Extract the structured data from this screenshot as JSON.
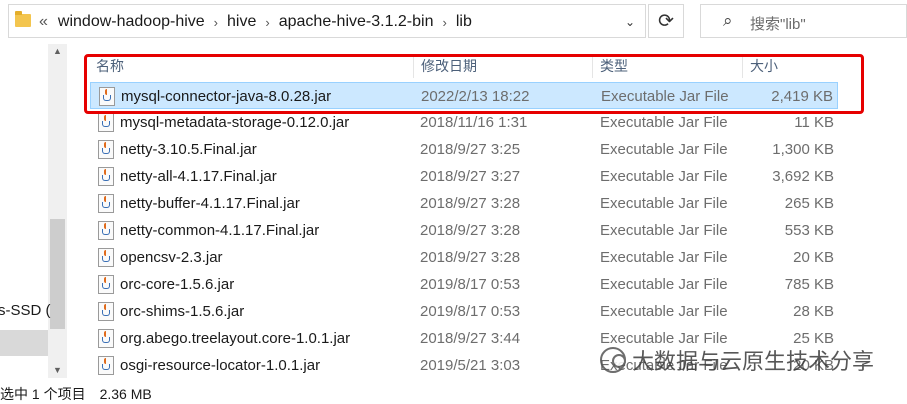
{
  "address_bar": {
    "overflow_glyph": "«",
    "crumbs": [
      "window-hadoop-hive",
      "hive",
      "apache-hive-3.1.2-bin",
      "lib"
    ],
    "separator": "›",
    "dropdown_glyph": "⌄"
  },
  "refresh_glyph": "⟳",
  "search": {
    "icon_glyph": "⌕",
    "placeholder": "搜索\"lib\""
  },
  "nav": {
    "drive_label": "s-SSD (",
    "scroll_up": "▲",
    "scroll_down": "▼"
  },
  "columns": {
    "name": "名称",
    "date": "修改日期",
    "type": "类型",
    "size": "大小"
  },
  "files": [
    {
      "name": "mysql-connector-java-8.0.28.jar",
      "date": "2022/2/13 18:22",
      "type": "Executable Jar File",
      "size": "2,419 KB",
      "selected": true
    },
    {
      "name": "mysql-metadata-storage-0.12.0.jar",
      "date": "2018/11/16 1:31",
      "type": "Executable Jar File",
      "size": "11 KB",
      "selected": false
    },
    {
      "name": "netty-3.10.5.Final.jar",
      "date": "2018/9/27 3:25",
      "type": "Executable Jar File",
      "size": "1,300 KB",
      "selected": false
    },
    {
      "name": "netty-all-4.1.17.Final.jar",
      "date": "2018/9/27 3:27",
      "type": "Executable Jar File",
      "size": "3,692 KB",
      "selected": false
    },
    {
      "name": "netty-buffer-4.1.17.Final.jar",
      "date": "2018/9/27 3:28",
      "type": "Executable Jar File",
      "size": "265 KB",
      "selected": false
    },
    {
      "name": "netty-common-4.1.17.Final.jar",
      "date": "2018/9/27 3:28",
      "type": "Executable Jar File",
      "size": "553 KB",
      "selected": false
    },
    {
      "name": "opencsv-2.3.jar",
      "date": "2018/9/27 3:28",
      "type": "Executable Jar File",
      "size": "20 KB",
      "selected": false
    },
    {
      "name": "orc-core-1.5.6.jar",
      "date": "2019/8/17 0:53",
      "type": "Executable Jar File",
      "size": "785 KB",
      "selected": false
    },
    {
      "name": "orc-shims-1.5.6.jar",
      "date": "2019/8/17 0:53",
      "type": "Executable Jar File",
      "size": "28 KB",
      "selected": false
    },
    {
      "name": "org.abego.treelayout.core-1.0.1.jar",
      "date": "2018/9/27 3:44",
      "type": "Executable Jar File",
      "size": "25 KB",
      "selected": false
    },
    {
      "name": "osgi-resource-locator-1.0.1.jar",
      "date": "2019/5/21 3:03",
      "type": "Executable Jar File",
      "size": "20 KB",
      "selected": false
    }
  ],
  "status": {
    "selection": "选中 1 个项目",
    "size": "2.36 MB"
  },
  "watermark": {
    "text": "大数据与云原生技术分享"
  },
  "colors": {
    "selection_bg": "#cce8ff",
    "highlight_border": "#e60000",
    "header_text": "#4c607a"
  }
}
